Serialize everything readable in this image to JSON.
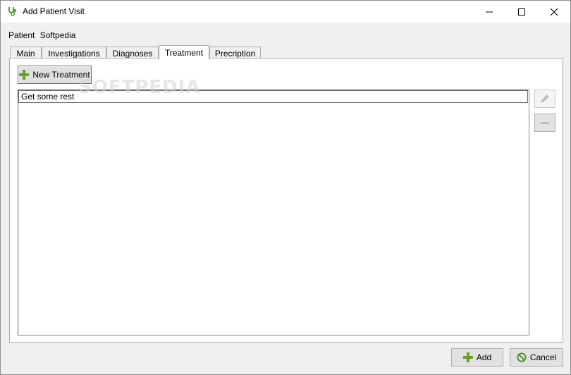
{
  "window": {
    "title": "Add Patient Visit",
    "controls": {
      "minimize": "minimize-icon",
      "maximize": "maximize-icon",
      "close": "close-icon"
    }
  },
  "patient": {
    "label": "Patient",
    "name": "Softpedia"
  },
  "tabs": [
    {
      "label": "Main",
      "active": false
    },
    {
      "label": "Investigations",
      "active": false
    },
    {
      "label": "Diagnoses",
      "active": false
    },
    {
      "label": "Treatment",
      "active": true
    },
    {
      "label": "Precription",
      "active": false
    }
  ],
  "treatment": {
    "new_button_label": "New Treatment",
    "items": [
      "Get some rest"
    ],
    "side_buttons": {
      "edit": "pencil-icon",
      "remove": "minus-icon"
    }
  },
  "footer": {
    "add_label": "Add",
    "cancel_label": "Cancel"
  },
  "watermark": "SOFTPEDIA",
  "colors": {
    "plus_green": "#6aa120",
    "cancel_green": "#4a8a1c",
    "app_icon": "#5aa02c"
  }
}
